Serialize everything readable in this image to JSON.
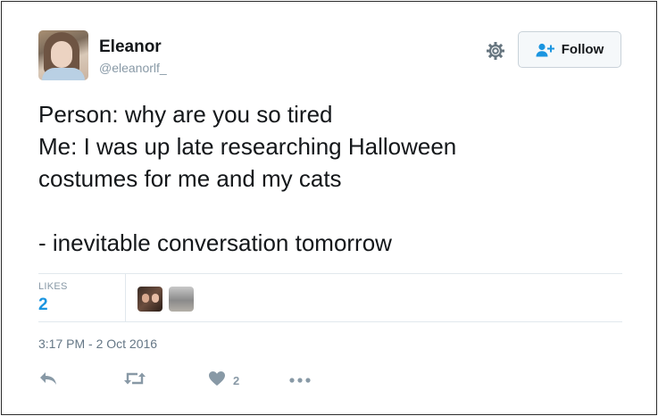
{
  "author": {
    "name": "Eleanor",
    "handle": "@eleanorlf_"
  },
  "header": {
    "follow_label": "Follow",
    "settings_icon": "gear-icon",
    "follow_icon": "person-plus-icon"
  },
  "tweet": {
    "text": "Person: why are you so tired\nMe: I was up late researching Halloween\ncostumes for me and my cats\n\n- inevitable conversation tomorrow"
  },
  "stats": {
    "likes_label": "LIKES",
    "likes_count": "2"
  },
  "meta": {
    "timestamp": "3:17 PM - 2 Oct 2016"
  },
  "actions": {
    "like_count": "2"
  },
  "colors": {
    "accent": "#1b95e0",
    "muted": "#8899a6",
    "text": "#14171a",
    "border": "#e1e8ed"
  }
}
